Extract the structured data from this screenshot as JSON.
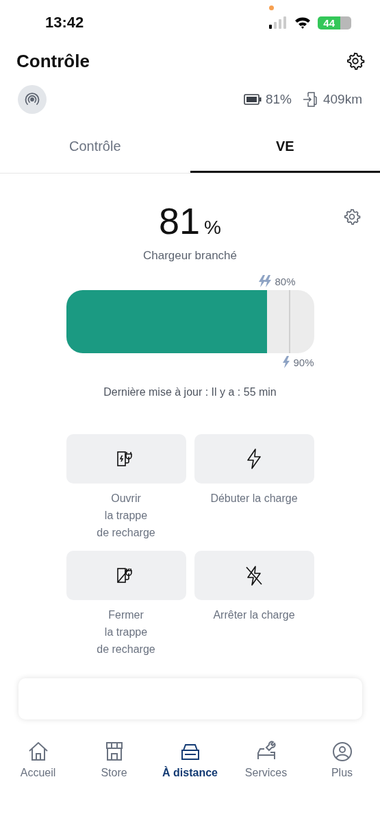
{
  "status_bar": {
    "time": "13:42",
    "battery": "44"
  },
  "header": {
    "title": "Contrôle"
  },
  "vehicle_info": {
    "battery": "81%",
    "range": "409km"
  },
  "tabs": [
    {
      "label": "Contrôle",
      "selected": false
    },
    {
      "label": "VE",
      "selected": true
    }
  ],
  "charge": {
    "value": "81",
    "unit": "%",
    "status": "Chargeur branché",
    "level": 0.81,
    "limits": [
      {
        "kind": "ac",
        "label": "80%"
      },
      {
        "kind": "dc",
        "label": "90%",
        "level": 0.9
      }
    ],
    "updated": "Dernière mise à jour : Il y a : 55 min"
  },
  "actions": [
    {
      "kind": "open-flap",
      "lines": [
        "Ouvrir",
        "la trappe",
        "de recharge"
      ]
    },
    {
      "kind": "start",
      "lines": [
        "Débuter la charge"
      ]
    },
    {
      "kind": "close-flap",
      "lines": [
        "Fermer",
        "la trappe",
        "de recharge"
      ]
    },
    {
      "kind": "stop",
      "lines": [
        "Arrêter la charge"
      ]
    }
  ],
  "bottom_nav": [
    {
      "kind": "home",
      "label": "Accueil",
      "selected": false
    },
    {
      "kind": "store",
      "label": "Store",
      "selected": false
    },
    {
      "kind": "remote",
      "label": "À distance",
      "selected": true
    },
    {
      "kind": "services",
      "label": "Services",
      "selected": false
    },
    {
      "kind": "more",
      "label": "Plus",
      "selected": false
    }
  ]
}
